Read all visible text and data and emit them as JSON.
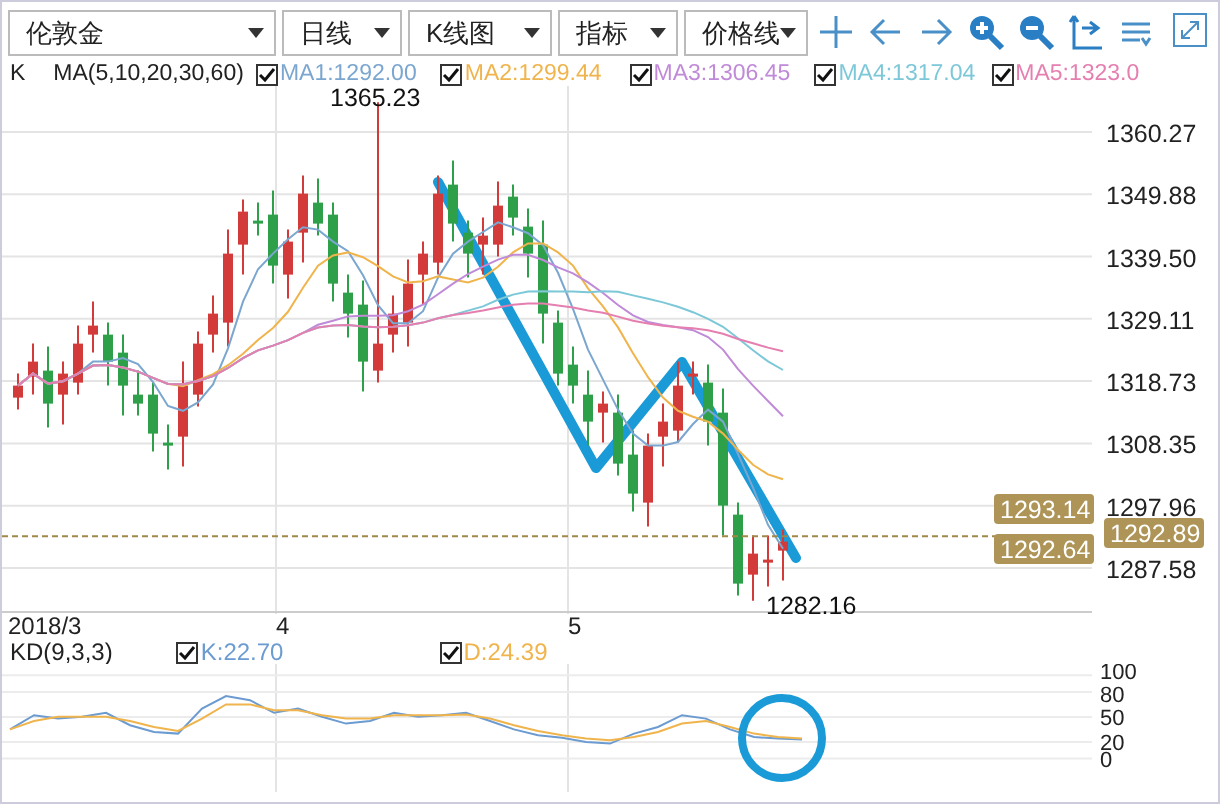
{
  "toolbar": {
    "dropdowns": [
      "伦敦金",
      "日线",
      "K线图",
      "指标",
      "价格线"
    ]
  },
  "price_legend": {
    "chart_label": "K",
    "indicator": "MA(5,10,20,30,60)",
    "lines": [
      {
        "text": "MA1:1292.00",
        "color": "#7aa6d0",
        "checked": true
      },
      {
        "text": "MA2:1299.44",
        "color": "#f0b44c",
        "checked": true
      },
      {
        "text": "MA3:1306.45",
        "color": "#c08ad8",
        "checked": true
      },
      {
        "text": "MA4:1317.04",
        "color": "#7cc8d8",
        "checked": true
      },
      {
        "text": "MA5:1323.0",
        "color": "#e57fb0",
        "checked": true
      }
    ]
  },
  "price_chart": {
    "y_axis_labels": [
      "1360.27",
      "1349.88",
      "1339.50",
      "1329.11",
      "1318.73",
      "1308.35",
      "1297.96",
      "1287.58"
    ],
    "high_label": "1365.23",
    "low_label": "1282.16",
    "price_tags": [
      {
        "text": "1293.14",
        "kind": "plot"
      },
      {
        "text": "1292.89",
        "kind": "axis"
      },
      {
        "text": "1292.64",
        "kind": "plot"
      }
    ]
  },
  "date_axis": [
    "2018/3",
    "4",
    "5"
  ],
  "kd_legend": {
    "indicator": "KD(9,3,3)",
    "lines": [
      {
        "text": "K:22.70",
        "color": "#6b9bd0",
        "checked": true
      },
      {
        "text": "D:24.39",
        "color": "#f0b44c",
        "checked": true
      }
    ]
  },
  "kd_axis_labels": [
    "100",
    "80",
    "50",
    "20",
    "0"
  ]
}
